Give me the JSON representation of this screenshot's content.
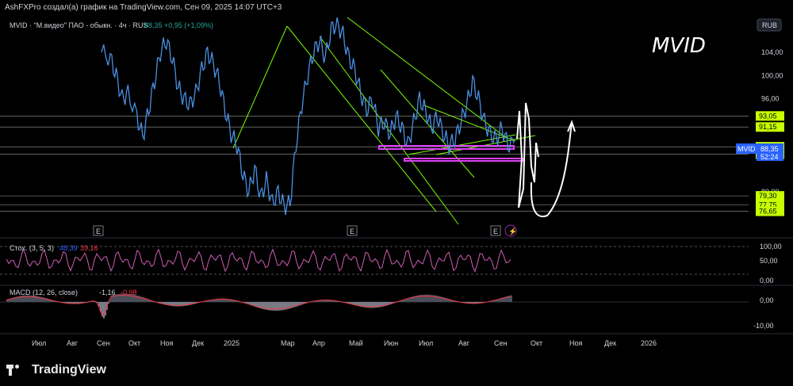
{
  "header": {
    "caption": "AshFXPro создал(а) график на TradingView.com, Сен 09, 2025 14:07 UTC+3"
  },
  "symbol": {
    "legend": "MVID · \"М.видео\" ПАО - обыкн. · 4ч · RUS",
    "price": "88,35",
    "change": "+0,95 (+1,09%)",
    "watermark": "MVID",
    "ticker": "MVID",
    "currency": "RUB",
    "last_price": "88,35",
    "countdown": "52:24"
  },
  "chart_data": {
    "type": "line",
    "x_labels": [
      "Июл",
      "Авг",
      "Сен",
      "Окт",
      "Ноя",
      "Дек",
      "2025",
      "Мар",
      "Апр",
      "Май",
      "Июн",
      "Июл",
      "Авг",
      "Сен",
      "Окт",
      "Ноя",
      "Дек",
      "2026"
    ],
    "y_ticks": [
      "104,00",
      "100,00",
      "96,00",
      "80,00"
    ],
    "y_range": [
      74,
      110
    ],
    "level_labels": [
      {
        "value": 93.05,
        "text": "93,05"
      },
      {
        "value": 91.15,
        "text": "91,15"
      },
      {
        "value": 87.75,
        "text": "87,75"
      },
      {
        "value": 86.45,
        "text": "86,45"
      },
      {
        "value": 79.3,
        "text": "79,30"
      },
      {
        "value": 77.75,
        "text": "77,75"
      },
      {
        "value": 76.65,
        "text": "76,65"
      }
    ],
    "price_series": [
      [
        0,
        104
      ],
      [
        3,
        103
      ],
      [
        5,
        100
      ],
      [
        7,
        96
      ],
      [
        9,
        97
      ],
      [
        12,
        93
      ],
      [
        14,
        89.5
      ],
      [
        16,
        94
      ],
      [
        18,
        99
      ],
      [
        20,
        104
      ],
      [
        22,
        106
      ],
      [
        24,
        103
      ],
      [
        26,
        98
      ],
      [
        28,
        96
      ],
      [
        30,
        95
      ],
      [
        32,
        97
      ],
      [
        34,
        101
      ],
      [
        36,
        104
      ],
      [
        38,
        102
      ],
      [
        40,
        99
      ],
      [
        42,
        94
      ],
      [
        44,
        90
      ],
      [
        46,
        88
      ],
      [
        48,
        83
      ],
      [
        50,
        80
      ],
      [
        52,
        84
      ],
      [
        54,
        79
      ],
      [
        56,
        82
      ],
      [
        58,
        78
      ],
      [
        60,
        80
      ],
      [
        62,
        77.5
      ],
      [
        64,
        78
      ],
      [
        66,
        88
      ],
      [
        68,
        95
      ],
      [
        70,
        100
      ],
      [
        72,
        104
      ],
      [
        74,
        106
      ],
      [
        76,
        103
      ],
      [
        78,
        108
      ],
      [
        80,
        109
      ],
      [
        82,
        107
      ],
      [
        84,
        103
      ],
      [
        86,
        101
      ],
      [
        88,
        97
      ],
      [
        90,
        94
      ],
      [
        92,
        96
      ],
      [
        94,
        91
      ],
      [
        96,
        92
      ],
      [
        98,
        90
      ],
      [
        100,
        93
      ],
      [
        102,
        91
      ],
      [
        104,
        88
      ],
      [
        106,
        92
      ],
      [
        108,
        96
      ],
      [
        110,
        94
      ],
      [
        112,
        91
      ],
      [
        114,
        93
      ],
      [
        116,
        90
      ],
      [
        118,
        88
      ],
      [
        120,
        89
      ],
      [
        122,
        92
      ],
      [
        124,
        95
      ],
      [
        126,
        99
      ],
      [
        128,
        96
      ],
      [
        130,
        92
      ],
      [
        132,
        90
      ],
      [
        134,
        89
      ],
      [
        136,
        91
      ],
      [
        138,
        88
      ],
      [
        140,
        88.35
      ]
    ],
    "stoch": {
      "label": "Стох. (3, 5, 3)",
      "k": "48,39",
      "d": "39,16",
      "ticks": [
        "100,00",
        "50,00",
        "0,00"
      ]
    },
    "macd": {
      "label": "MACD (12, 26, close)",
      "macd": "-1,16",
      "signal": "-0,98",
      "ticks": [
        "0,00",
        "-10,00"
      ]
    },
    "event_markers": [
      "E",
      "E",
      "E"
    ],
    "grid": false
  },
  "branding": {
    "name": "TradingView"
  },
  "colors": {
    "price": "#4a90e2",
    "trend": "#7cfc00",
    "zone": "#e040fb",
    "label_bg": "#c6ff00",
    "stoch": "#d05cb5",
    "macd_pos": "#f23645",
    "macd_neg": "#787b86"
  }
}
